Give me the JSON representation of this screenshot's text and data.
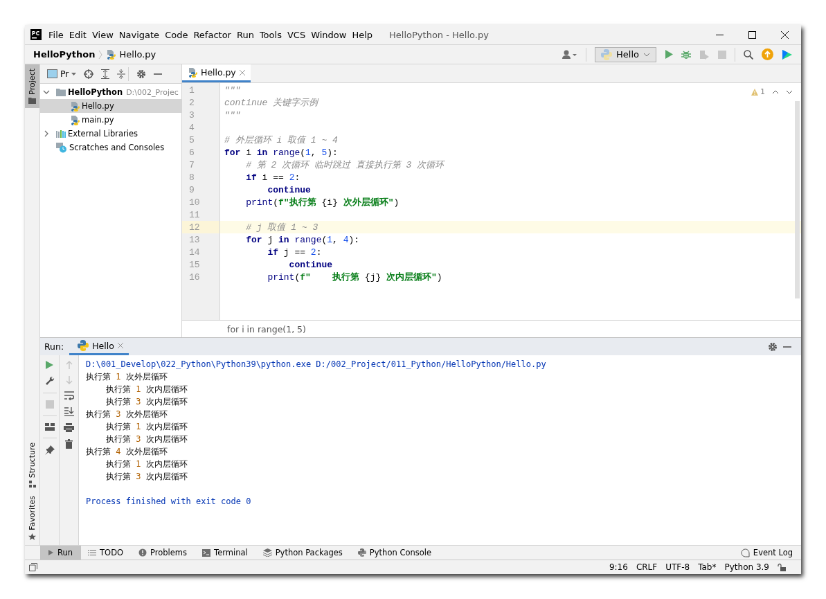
{
  "window": {
    "title": "HelloPython - Hello.py"
  },
  "menu": [
    "File",
    "Edit",
    "View",
    "Navigate",
    "Code",
    "Refactor",
    "Run",
    "Tools",
    "VCS",
    "Window",
    "Help"
  ],
  "navbar": {
    "project": "HelloPython",
    "file": "Hello.py"
  },
  "toolbar": {
    "run_config": "Hello"
  },
  "side_tabs_left": [
    {
      "label": "Project",
      "selected": true
    },
    {
      "label": "Structure",
      "selected": false
    },
    {
      "label": "Favorites",
      "selected": false
    }
  ],
  "project_panel": {
    "view": "Pr",
    "tree": [
      {
        "label": "HelloPython",
        "path": "D:\\002_Projec",
        "kind": "folder",
        "expanded": true,
        "selected": false,
        "children": [
          {
            "label": "Hello.py",
            "kind": "python",
            "selected": true
          },
          {
            "label": "main.py",
            "kind": "python",
            "selected": false
          }
        ]
      },
      {
        "label": "External Libraries",
        "kind": "library",
        "expanded": false,
        "selected": false
      },
      {
        "label": "Scratches and Consoles",
        "kind": "scratch",
        "selected": false
      }
    ]
  },
  "editor": {
    "tabs": [
      {
        "label": "Hello.py",
        "selected": true
      }
    ],
    "warnings": "1",
    "breadcrumb": "for i in range(1, 5)",
    "lines": [
      {
        "number": "1",
        "current": false,
        "tokens": [
          {
            "text": "\"\"\"",
            "kind": "doc"
          }
        ]
      },
      {
        "number": "2",
        "current": false,
        "tokens": [
          {
            "text": "continue 关键字示例",
            "kind": "doc"
          }
        ]
      },
      {
        "number": "3",
        "current": false,
        "tokens": [
          {
            "text": "\"\"\"",
            "kind": "doc"
          }
        ]
      },
      {
        "number": "4",
        "current": false
      },
      {
        "number": "5",
        "current": false,
        "tokens": [
          {
            "text": "# 外层循环 i 取值 1 ~ 4",
            "kind": "comment"
          }
        ]
      },
      {
        "number": "6",
        "current": false,
        "tokens": [
          {
            "text": "for",
            "kind": "kw"
          },
          {
            "text": " i ",
            "kind": "plain"
          },
          {
            "text": "in",
            "kind": "kw"
          },
          {
            "text": " range",
            "kind": "fn"
          },
          {
            "text": "(",
            "kind": "plain"
          },
          {
            "text": "1",
            "kind": "num"
          },
          {
            "text": ", ",
            "kind": "plain"
          },
          {
            "text": "5",
            "kind": "num"
          },
          {
            "text": "):",
            "kind": "plain"
          }
        ]
      },
      {
        "number": "7",
        "current": false,
        "tokens": [
          {
            "text": "    # 第 2 次循环 临时跳过 直接执行第 3 次循环",
            "kind": "comment"
          }
        ]
      },
      {
        "number": "8",
        "current": false,
        "tokens": [
          {
            "text": "    if",
            "kind": "kw"
          },
          {
            "text": " i == ",
            "kind": "plain"
          },
          {
            "text": "2",
            "kind": "num"
          },
          {
            "text": ":",
            "kind": "plain"
          }
        ]
      },
      {
        "number": "9",
        "current": false,
        "tokens": [
          {
            "text": "        continue",
            "kind": "kw"
          }
        ]
      },
      {
        "number": "10",
        "current": false,
        "tokens": [
          {
            "text": "    print",
            "kind": "fn"
          },
          {
            "text": "(",
            "kind": "plain"
          },
          {
            "text": "f\"执行第 ",
            "kind": "str"
          },
          {
            "text": "{i}",
            "kind": "plain"
          },
          {
            "text": " 次外层循环\"",
            "kind": "str"
          },
          {
            "text": ")",
            "kind": "plain"
          }
        ]
      },
      {
        "number": "11",
        "current": false
      },
      {
        "number": "12",
        "current": true,
        "tokens": [
          {
            "text": "    # j 取值 1 ~ 3",
            "kind": "comment"
          }
        ]
      },
      {
        "number": "13",
        "current": false,
        "tokens": [
          {
            "text": "    for",
            "kind": "kw"
          },
          {
            "text": " j ",
            "kind": "plain"
          },
          {
            "text": "in",
            "kind": "kw"
          },
          {
            "text": " range",
            "kind": "fn"
          },
          {
            "text": "(",
            "kind": "plain"
          },
          {
            "text": "1",
            "kind": "num"
          },
          {
            "text": ", ",
            "kind": "plain"
          },
          {
            "text": "4",
            "kind": "num"
          },
          {
            "text": "):",
            "kind": "plain"
          }
        ]
      },
      {
        "number": "14",
        "current": false,
        "tokens": [
          {
            "text": "        if",
            "kind": "kw"
          },
          {
            "text": " j == ",
            "kind": "plain"
          },
          {
            "text": "2",
            "kind": "num"
          },
          {
            "text": ":",
            "kind": "plain"
          }
        ]
      },
      {
        "number": "15",
        "current": false,
        "tokens": [
          {
            "text": "            continue",
            "kind": "kw"
          }
        ]
      },
      {
        "number": "16",
        "current": false,
        "tokens": [
          {
            "text": "        print",
            "kind": "fn"
          },
          {
            "text": "(",
            "kind": "plain"
          },
          {
            "text": "f\"    执行第 ",
            "kind": "str"
          },
          {
            "text": "{j}",
            "kind": "plain"
          },
          {
            "text": " 次内层循环\"",
            "kind": "str"
          },
          {
            "text": ")",
            "kind": "plain"
          }
        ]
      }
    ]
  },
  "run_panel": {
    "label": "Run:",
    "tabs": [
      {
        "label": "Hello",
        "selected": true
      }
    ],
    "output": [
      {
        "tokens": [
          {
            "text": "D:\\001_Develop\\022_Python\\Python39\\python.exe D:/002_Project/011_Python/HelloPython/Hello.py",
            "kind": "sys"
          }
        ]
      },
      {
        "tokens": [
          {
            "text": "执行第 ",
            "kind": "out"
          },
          {
            "text": "1",
            "kind": "num"
          },
          {
            "text": " 次外层循环",
            "kind": "out"
          }
        ]
      },
      {
        "tokens": [
          {
            "text": "    执行第 ",
            "kind": "out"
          },
          {
            "text": "1",
            "kind": "num"
          },
          {
            "text": " 次内层循环",
            "kind": "out"
          }
        ]
      },
      {
        "tokens": [
          {
            "text": "    执行第 ",
            "kind": "out"
          },
          {
            "text": "3",
            "kind": "num"
          },
          {
            "text": " 次内层循环",
            "kind": "out"
          }
        ]
      },
      {
        "tokens": [
          {
            "text": "执行第 ",
            "kind": "out"
          },
          {
            "text": "3",
            "kind": "num"
          },
          {
            "text": " 次外层循环",
            "kind": "out"
          }
        ]
      },
      {
        "tokens": [
          {
            "text": "    执行第 ",
            "kind": "out"
          },
          {
            "text": "1",
            "kind": "num"
          },
          {
            "text": " 次内层循环",
            "kind": "out"
          }
        ]
      },
      {
        "tokens": [
          {
            "text": "    执行第 ",
            "kind": "out"
          },
          {
            "text": "3",
            "kind": "num"
          },
          {
            "text": " 次内层循环",
            "kind": "out"
          }
        ]
      },
      {
        "tokens": [
          {
            "text": "执行第 ",
            "kind": "out"
          },
          {
            "text": "4",
            "kind": "num"
          },
          {
            "text": " 次外层循环",
            "kind": "out"
          }
        ]
      },
      {
        "tokens": [
          {
            "text": "    执行第 ",
            "kind": "out"
          },
          {
            "text": "1",
            "kind": "num"
          },
          {
            "text": " 次内层循环",
            "kind": "out"
          }
        ]
      },
      {
        "tokens": [
          {
            "text": "    执行第 ",
            "kind": "out"
          },
          {
            "text": "3",
            "kind": "num"
          },
          {
            "text": " 次内层循环",
            "kind": "out"
          }
        ]
      },
      {
        "kind": "exit",
        "tokens": [
          {
            "text": "Process finished with exit code 0",
            "kind": "sys"
          }
        ]
      }
    ]
  },
  "tool_windows": [
    {
      "label": "Run",
      "kind": "run",
      "selected": true
    },
    {
      "label": "TODO",
      "kind": "todo",
      "selected": false
    },
    {
      "label": "Problems",
      "kind": "problems",
      "selected": false
    },
    {
      "label": "Terminal",
      "kind": "terminal",
      "selected": false
    },
    {
      "label": "Python Packages",
      "kind": "packages",
      "selected": false
    },
    {
      "label": "Python Console",
      "kind": "console",
      "selected": false
    }
  ],
  "event_log": "Event Log",
  "status_bar": [
    "9:16",
    "CRLF",
    "UTF-8",
    "Tab*",
    "Python 3.9"
  ]
}
